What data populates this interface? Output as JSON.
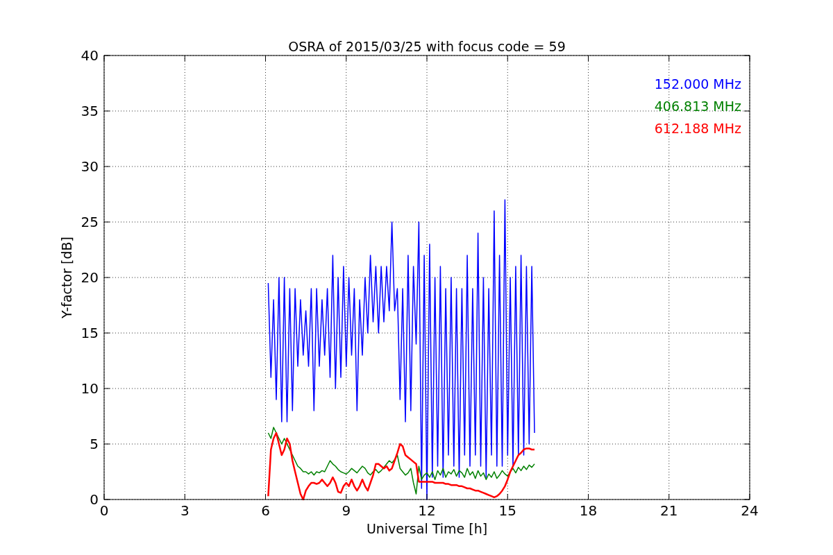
{
  "chart": {
    "chart_data": {
      "type": "line",
      "grid": true,
      "title": "OSRA of 2015/03/25 with focus code = 59",
      "xlabel": "Universal Time [h]",
      "ylabel": "Y-factor [dB]",
      "xlim": [
        0,
        24
      ],
      "ylim": [
        0,
        40
      ],
      "xticks": [
        0,
        3,
        6,
        9,
        12,
        15,
        18,
        21,
        24
      ],
      "yticks": [
        0,
        5,
        10,
        15,
        20,
        25,
        30,
        35,
        40
      ],
      "x": [
        6.1,
        6.2,
        6.3,
        6.4,
        6.5,
        6.6,
        6.7,
        6.8,
        6.9,
        7.0,
        7.1,
        7.2,
        7.3,
        7.4,
        7.5,
        7.6,
        7.7,
        7.8,
        7.9,
        8.0,
        8.1,
        8.2,
        8.3,
        8.4,
        8.5,
        8.6,
        8.7,
        8.8,
        8.9,
        9.0,
        9.1,
        9.2,
        9.3,
        9.4,
        9.5,
        9.6,
        9.7,
        9.8,
        9.9,
        10.0,
        10.1,
        10.2,
        10.3,
        10.4,
        10.5,
        10.6,
        10.7,
        10.8,
        10.9,
        11.0,
        11.1,
        11.2,
        11.3,
        11.4,
        11.5,
        11.6,
        11.7,
        11.8,
        11.9,
        12.0,
        12.1,
        12.2,
        12.3,
        12.4,
        12.5,
        12.6,
        12.7,
        12.8,
        12.9,
        13.0,
        13.1,
        13.2,
        13.3,
        13.4,
        13.5,
        13.6,
        13.7,
        13.8,
        13.9,
        14.0,
        14.1,
        14.2,
        14.3,
        14.4,
        14.5,
        14.6,
        14.7,
        14.8,
        14.9,
        15.0,
        15.1,
        15.2,
        15.3,
        15.4,
        15.5,
        15.6,
        15.7,
        15.8,
        15.9,
        16.0
      ],
      "series": [
        {
          "name": "152.000 MHz",
          "color": "#0000ff",
          "values": [
            19.5,
            11,
            18,
            9,
            20,
            7,
            20,
            7,
            19,
            8,
            19,
            12,
            18,
            13,
            17,
            12,
            19,
            8,
            19,
            12,
            18,
            13,
            19,
            11,
            22,
            10,
            20,
            11,
            21,
            12,
            20,
            13,
            19,
            8,
            18,
            13,
            20,
            15,
            22,
            16,
            21,
            15,
            21,
            16,
            21,
            17,
            25,
            17,
            19,
            9,
            19,
            7,
            22,
            8,
            21,
            14,
            25,
            1,
            22,
            0,
            23,
            2,
            20,
            3,
            21,
            2,
            19,
            4,
            20,
            3,
            19,
            2,
            19,
            4,
            22,
            3,
            19,
            4,
            24,
            3,
            20,
            2,
            19,
            4,
            26,
            3,
            22,
            3,
            27,
            4,
            20,
            3,
            21,
            4,
            22,
            4,
            21,
            5,
            21,
            6
          ]
        },
        {
          "name": "406.813 MHz",
          "color": "#008000",
          "values": [
            6,
            5.5,
            6.5,
            6,
            5.5,
            5,
            5.5,
            5,
            4.5,
            4,
            3.5,
            3,
            2.8,
            2.5,
            2.5,
            2.3,
            2.5,
            2.2,
            2.5,
            2.4,
            2.6,
            2.5,
            3,
            3.5,
            3.2,
            3,
            2.7,
            2.5,
            2.4,
            2.3,
            2.5,
            2.8,
            2.6,
            2.4,
            2.7,
            3,
            2.8,
            2.4,
            2.2,
            2.5,
            2.7,
            2.4,
            2.6,
            2.9,
            3.2,
            3.5,
            3.3,
            3.6,
            4,
            2.8,
            2.5,
            2.2,
            2.4,
            2.8,
            1.5,
            0.5,
            3,
            1.8,
            2.2,
            2.4,
            2,
            2.5,
            1.8,
            2.6,
            2.2,
            2.8,
            2,
            2.5,
            2.3,
            2.7,
            2.1,
            2.6,
            2.4,
            2,
            2.8,
            2.2,
            2.5,
            1.9,
            2.6,
            2.1,
            2.4,
            1.8,
            2.3,
            2,
            2.5,
            1.9,
            2.2,
            2.6,
            2.3,
            2.1,
            2.5,
            2.8,
            2.4,
            2.9,
            2.6,
            3,
            2.7,
            3.1,
            2.9,
            3.2
          ]
        },
        {
          "name": "612.188 MHz",
          "color": "#ff0000",
          "values": [
            0.3,
            4.5,
            5.5,
            6,
            5,
            4,
            4.5,
            5.5,
            5,
            3.5,
            2.5,
            1.5,
            0.5,
            0,
            0.8,
            1.2,
            1.5,
            1.5,
            1.4,
            1.5,
            1.8,
            1.5,
            1.2,
            1.5,
            2,
            1.5,
            0.7,
            0.6,
            1.2,
            1.5,
            1.2,
            1.8,
            1.2,
            0.8,
            1.2,
            1.8,
            1.2,
            0.8,
            1.5,
            2.2,
            3.2,
            3.2,
            3,
            2.8,
            3,
            2.6,
            2.8,
            3.5,
            4.2,
            5,
            4.8,
            4,
            3.8,
            3.6,
            3.4,
            3.2,
            1.6,
            1.6,
            1.6,
            1.6,
            1.6,
            1.6,
            1.5,
            1.5,
            1.5,
            1.5,
            1.4,
            1.4,
            1.3,
            1.3,
            1.3,
            1.2,
            1.2,
            1.1,
            1.0,
            1.0,
            0.9,
            0.8,
            0.8,
            0.7,
            0.6,
            0.5,
            0.4,
            0.3,
            0.2,
            0.3,
            0.5,
            0.8,
            1.2,
            1.8,
            2.5,
            3,
            3.5,
            4,
            4.2,
            4.5,
            4.6,
            4.6,
            4.5,
            4.5
          ]
        }
      ]
    }
  }
}
